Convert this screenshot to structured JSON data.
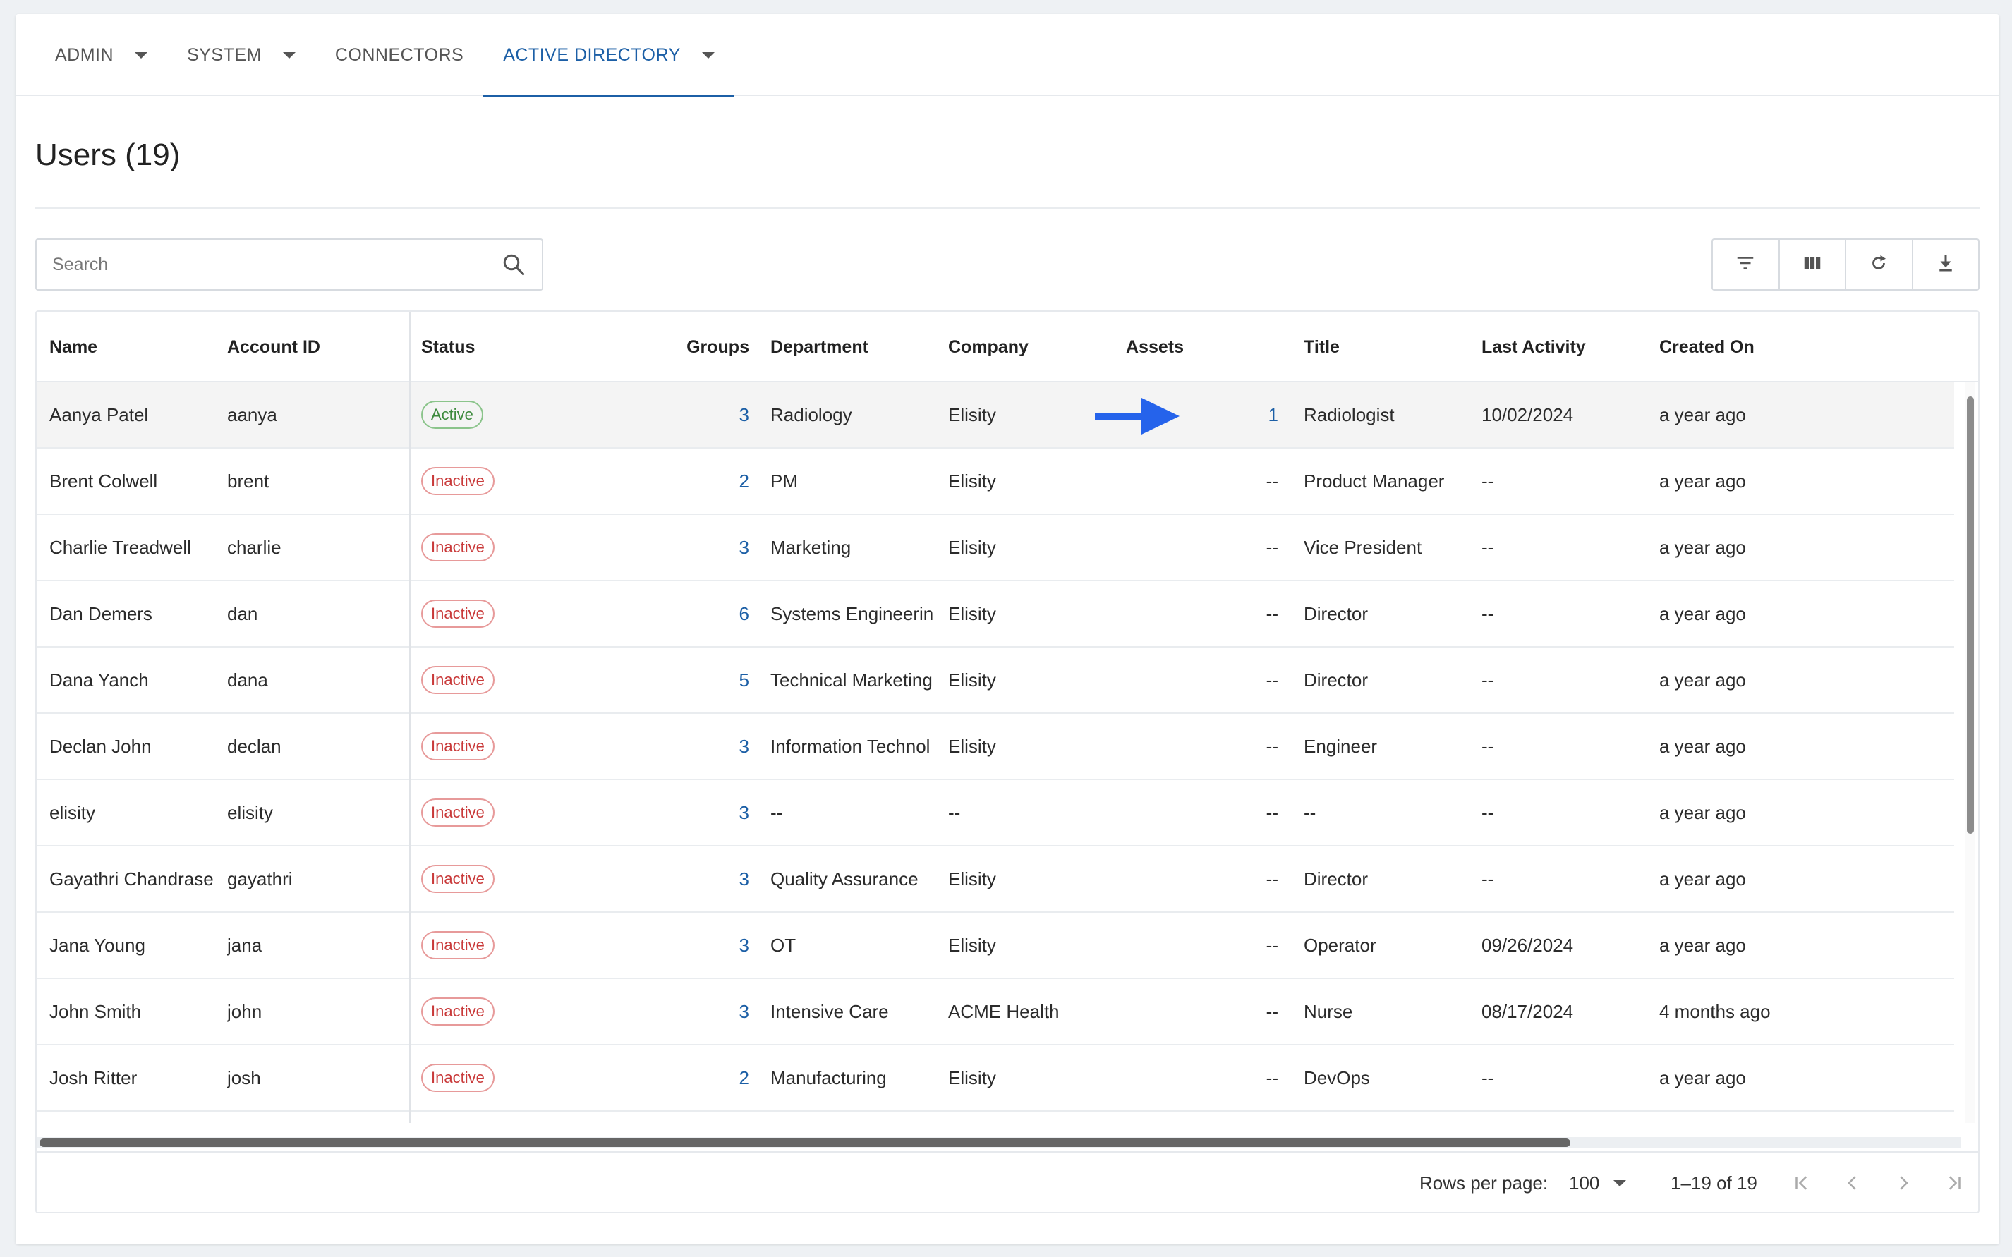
{
  "tabs": [
    {
      "label": "ADMIN",
      "has_caret": true,
      "active": false
    },
    {
      "label": "SYSTEM",
      "has_caret": true,
      "active": false
    },
    {
      "label": "CONNECTORS",
      "has_caret": false,
      "active": false
    },
    {
      "label": "ACTIVE DIRECTORY",
      "has_caret": true,
      "active": true
    }
  ],
  "page": {
    "title": "Users (19)"
  },
  "search": {
    "placeholder": "Search",
    "value": ""
  },
  "toolbar": {
    "icons": [
      "filter-icon",
      "columns-icon",
      "refresh-icon",
      "download-icon"
    ]
  },
  "table": {
    "columns": [
      "Name",
      "Account ID",
      "Status",
      "Groups",
      "Department",
      "Company",
      "Assets",
      "Title",
      "Last Activity",
      "Created On"
    ],
    "rows": [
      {
        "name": "Aanya Patel",
        "account": "aanya",
        "status": "Active",
        "groups": "3",
        "department": "Radiology",
        "company": "Elisity",
        "assets": "1",
        "title": "Radiologist",
        "last_activity": "10/02/2024",
        "created": "a year ago"
      },
      {
        "name": "Brent Colwell",
        "account": "brent",
        "status": "Inactive",
        "groups": "2",
        "department": "PM",
        "company": "Elisity",
        "assets": "--",
        "title": "Product Manager",
        "last_activity": "--",
        "created": "a year ago"
      },
      {
        "name": "Charlie Treadwell",
        "account": "charlie",
        "status": "Inactive",
        "groups": "3",
        "department": "Marketing",
        "company": "Elisity",
        "assets": "--",
        "title": "Vice President",
        "last_activity": "--",
        "created": "a year ago"
      },
      {
        "name": "Dan Demers",
        "account": "dan",
        "status": "Inactive",
        "groups": "6",
        "department": "Systems Engineerin",
        "company": "Elisity",
        "assets": "--",
        "title": "Director",
        "last_activity": "--",
        "created": "a year ago"
      },
      {
        "name": "Dana Yanch",
        "account": "dana",
        "status": "Inactive",
        "groups": "5",
        "department": "Technical Marketing",
        "company": "Elisity",
        "assets": "--",
        "title": "Director",
        "last_activity": "--",
        "created": "a year ago"
      },
      {
        "name": "Declan John",
        "account": "declan",
        "status": "Inactive",
        "groups": "3",
        "department": "Information Technol",
        "company": "Elisity",
        "assets": "--",
        "title": "Engineer",
        "last_activity": "--",
        "created": "a year ago"
      },
      {
        "name": "elisity",
        "account": "elisity",
        "status": "Inactive",
        "groups": "3",
        "department": "--",
        "company": "--",
        "assets": "--",
        "title": "--",
        "last_activity": "--",
        "created": "a year ago"
      },
      {
        "name": "Gayathri Chandrase",
        "account": "gayathri",
        "status": "Inactive",
        "groups": "3",
        "department": "Quality Assurance",
        "company": "Elisity",
        "assets": "--",
        "title": "Director",
        "last_activity": "--",
        "created": "a year ago"
      },
      {
        "name": "Jana Young",
        "account": "jana",
        "status": "Inactive",
        "groups": "3",
        "department": "OT",
        "company": "Elisity",
        "assets": "--",
        "title": "Operator",
        "last_activity": "09/26/2024",
        "created": "a year ago"
      },
      {
        "name": "John Smith",
        "account": "john",
        "status": "Inactive",
        "groups": "3",
        "department": "Intensive Care",
        "company": "ACME Health",
        "assets": "--",
        "title": "Nurse",
        "last_activity": "08/17/2024",
        "created": "4 months ago"
      },
      {
        "name": "Josh Ritter",
        "account": "josh",
        "status": "Inactive",
        "groups": "2",
        "department": "Manufacturing",
        "company": "Elisity",
        "assets": "--",
        "title": "DevOps",
        "last_activity": "--",
        "created": "a year ago"
      }
    ]
  },
  "pagination": {
    "rows_per_page_label": "Rows per page:",
    "rows_per_page_value": "100",
    "range": "1–19 of 19"
  },
  "colors": {
    "accent": "#1c5fa6",
    "active": "#3d8a3d",
    "inactive": "#c93a3a",
    "annotation_arrow": "#2563eb"
  }
}
